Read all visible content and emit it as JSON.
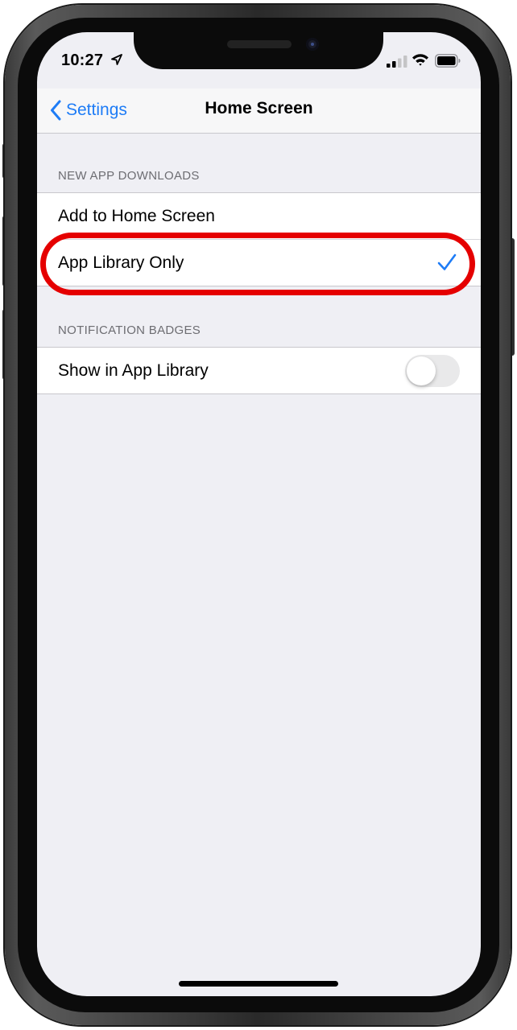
{
  "status_bar": {
    "time": "10:27",
    "icons": [
      "location-arrow-icon",
      "cellular-signal-icon",
      "wifi-icon",
      "battery-icon"
    ]
  },
  "navbar": {
    "back_label": "Settings",
    "title": "Home Screen"
  },
  "sections": {
    "new_app_downloads": {
      "header": "NEW APP DOWNLOADS",
      "options": [
        {
          "label": "Add to Home Screen",
          "selected": false
        },
        {
          "label": "App Library Only",
          "selected": true
        }
      ]
    },
    "notification_badges": {
      "header": "NOTIFICATION BADGES",
      "row": {
        "label": "Show in App Library",
        "toggle_on": false
      }
    }
  },
  "colors": {
    "accent": "#1e7cf6",
    "highlight": "#e50000",
    "background": "#efeff4"
  }
}
